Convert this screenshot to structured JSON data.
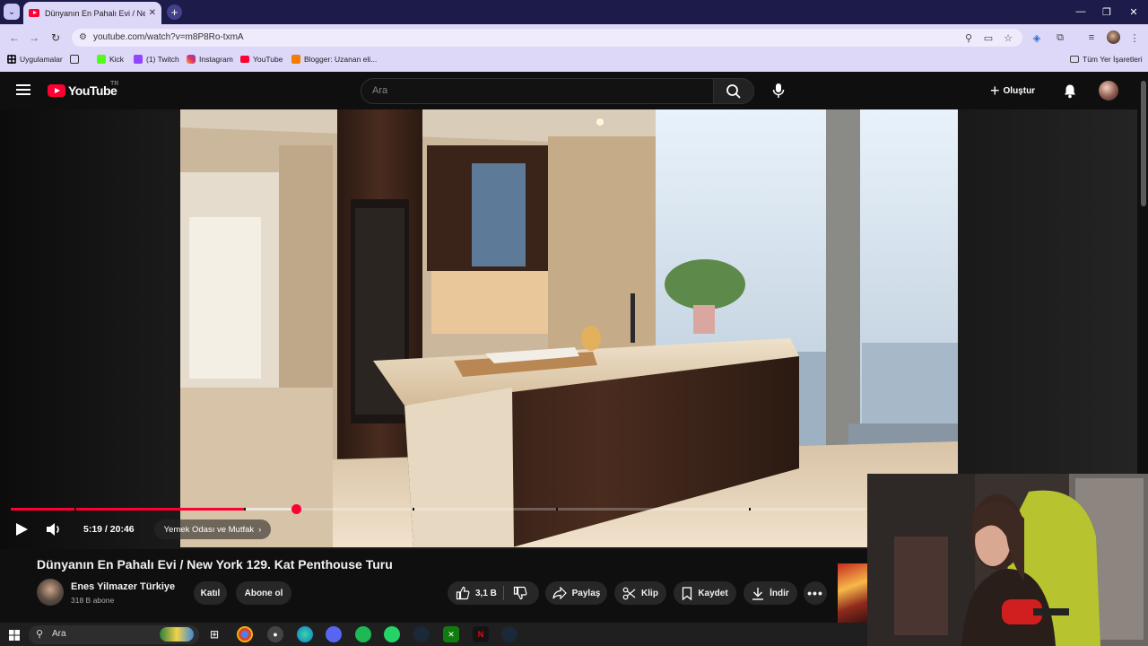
{
  "browser": {
    "tab_title": "Dünyanın En Pahalı Evi / New Y",
    "url": "youtube.com/watch?v=m8P8Ro-txmA",
    "bookmarks": [
      {
        "label": "Uygulamalar",
        "icon": "apps-grid-icon"
      },
      {
        "label": "Kick",
        "icon": "kick-icon"
      },
      {
        "label": "(1) Twitch",
        "icon": "twitch-icon"
      },
      {
        "label": "Instagram",
        "icon": "instagram-icon"
      },
      {
        "label": "YouTube",
        "icon": "youtube-icon"
      },
      {
        "label": "Blogger: Uzanan eli...",
        "icon": "blogger-icon"
      }
    ],
    "all_bookmarks_label": "Tüm Yer İşaretleri"
  },
  "youtube": {
    "country_code": "TR",
    "wordmark": "YouTube",
    "search_placeholder": "Ara",
    "create_label": "Oluştur"
  },
  "player": {
    "current_time": "5:19",
    "duration": "20:46",
    "time_display": "5:19 / 20:46",
    "chapter": "Yemek Odası ve Mutfak",
    "progress_fraction": 0.333,
    "buffered_fraction": 0.274,
    "accent_color": "#ff0033"
  },
  "video": {
    "title": "Dünyanın En Pahalı Evi / New York 129. Kat Penthouse Turu",
    "channel_name": "Enes Yilmazer Türkiye",
    "subscribers": "318 B abone",
    "join_label": "Katıl",
    "subscribe_label": "Abone ol",
    "like_count": "3,1 B",
    "share_label": "Paylaş",
    "clip_label": "Klip",
    "save_label": "Kaydet",
    "download_label": "İndir"
  },
  "taskbar": {
    "search_text": "Ara"
  }
}
